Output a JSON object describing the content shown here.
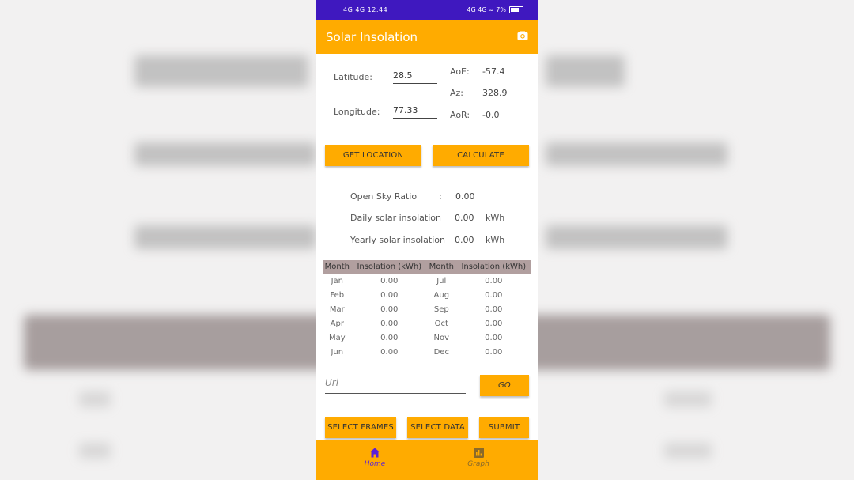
{
  "status_bar": {
    "left": "4G 4G 12:44",
    "right": "4G 4G ≈ 7%"
  },
  "app_bar": {
    "title": "Solar Insolation",
    "action_icon": "camera-icon"
  },
  "inputs": {
    "latitude_label": "Latitude:",
    "latitude_value": "28.5",
    "longitude_label": "Longitude:",
    "longitude_value": "77.33"
  },
  "angles": {
    "aoe_label": "AoE:",
    "aoe_value": "-57.4",
    "az_label": "Az:",
    "az_value": "328.9",
    "aor_label": "AoR:",
    "aor_value": "-0.0"
  },
  "buttons": {
    "get_location": "GET LOCATION",
    "calculate": "CALCULATE",
    "go": "GO",
    "select_frames": "SELECT FRAMES",
    "select_data": "SELECT DATA",
    "submit": "SUBMIT"
  },
  "results": {
    "open_sky_label": "Open Sky Ratio",
    "open_sky_sep": ":",
    "open_sky_value": "0.00",
    "daily_label": "Daily solar insolation",
    "daily_value": "0.00",
    "daily_unit": "kWh",
    "yearly_label": "Yearly solar insolation",
    "yearly_value": "0.00",
    "yearly_unit": "kWh"
  },
  "table": {
    "headers": [
      "Month",
      "Insolation (kWh)",
      "Month",
      "Insolation (kWh)"
    ],
    "rows": [
      [
        "Jan",
        "0.00",
        "Jul",
        "0.00"
      ],
      [
        "Feb",
        "0.00",
        "Aug",
        "0.00"
      ],
      [
        "Mar",
        "0.00",
        "Sep",
        "0.00"
      ],
      [
        "Apr",
        "0.00",
        "Oct",
        "0.00"
      ],
      [
        "May",
        "0.00",
        "Nov",
        "0.00"
      ],
      [
        "Jun",
        "0.00",
        "Dec",
        "0.00"
      ]
    ]
  },
  "url_field": {
    "placeholder": "Url",
    "value": ""
  },
  "bottom_nav": [
    {
      "label": "Home",
      "icon": "home-icon",
      "active": true
    },
    {
      "label": "Graph",
      "icon": "bar-chart-icon",
      "active": false
    }
  ],
  "colors": {
    "accent": "#ffab00",
    "status_bar": "#3f18bf",
    "active_nav": "#5a20d8",
    "table_header": "#b19f9f"
  }
}
